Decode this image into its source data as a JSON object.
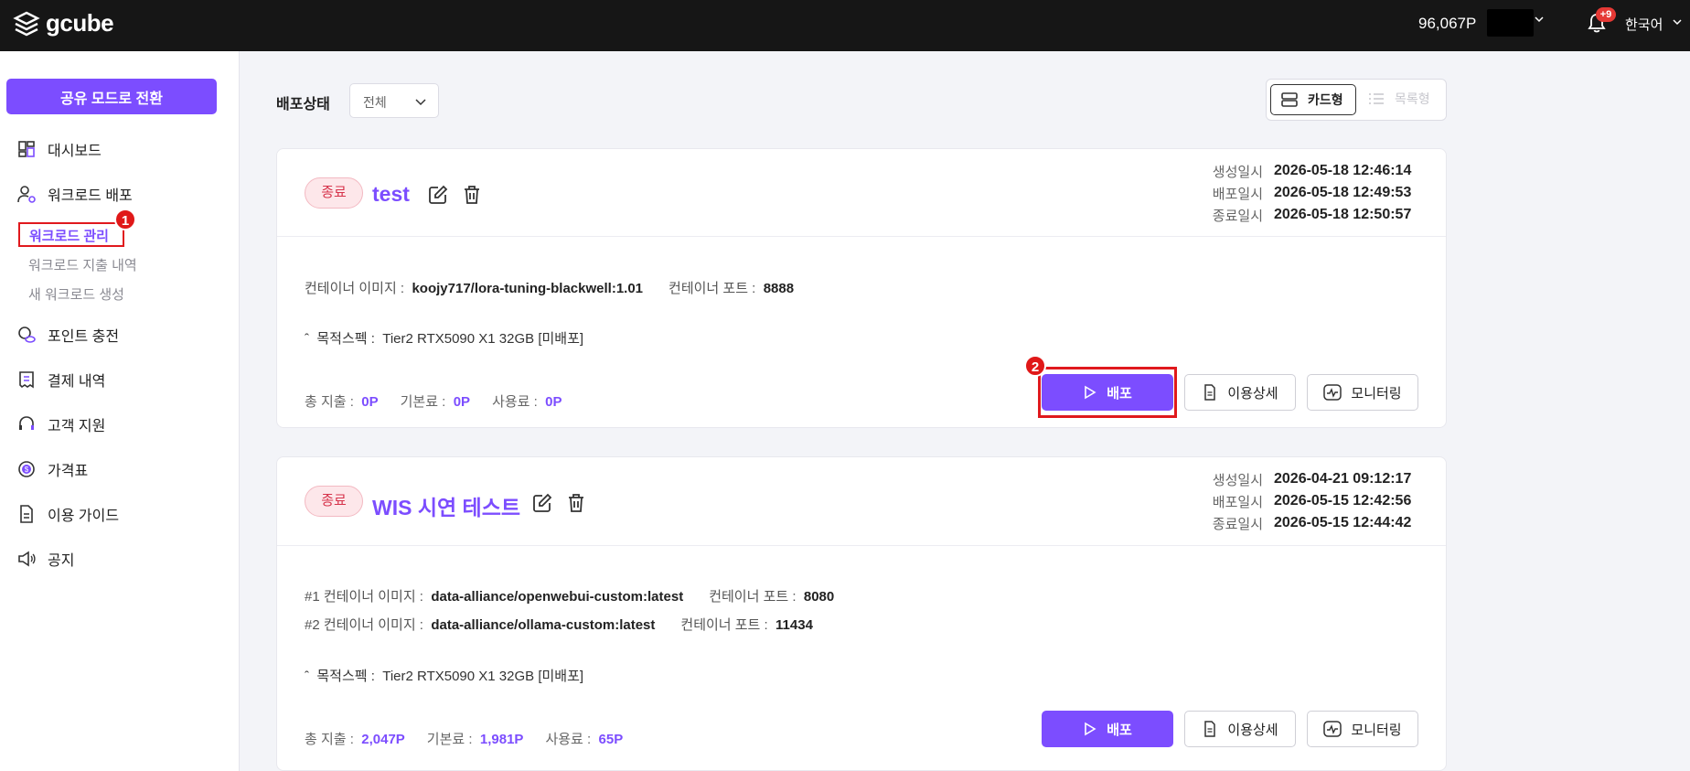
{
  "header": {
    "logo_text": "gcube",
    "points": "96,067P",
    "notification_badge": "+9",
    "language": "한국어"
  },
  "sidebar": {
    "mode_button": "공유 모드로 전환",
    "items": [
      {
        "label": "대시보드",
        "icon": "dashboard-icon"
      },
      {
        "label": "워크로드 배포",
        "icon": "user-gear-icon"
      },
      {
        "label": "포인트 충전",
        "icon": "coins-icon"
      },
      {
        "label": "결제 내역",
        "icon": "receipt-icon"
      },
      {
        "label": "고객 지원",
        "icon": "headset-icon"
      },
      {
        "label": "가격표",
        "icon": "dollar-icon"
      },
      {
        "label": "이용 가이드",
        "icon": "document-icon"
      },
      {
        "label": "공지",
        "icon": "megaphone-icon"
      }
    ],
    "sub_items": [
      "워크로드 관리",
      "워크로드 지출 내역",
      "새 워크로드 생성"
    ],
    "markers": [
      "1",
      "2"
    ]
  },
  "filter": {
    "label": "배포상태",
    "value": "전체"
  },
  "view_toggle": {
    "card": "카드형",
    "list": "목록형"
  },
  "labels": {
    "created": "생성일시",
    "deployed": "배포일시",
    "ended": "종료일시",
    "image": "컨테이너 이미지 :",
    "port": "컨테이너 포트 :",
    "spec": "목적스펙 :",
    "total": "총 지출 :",
    "base": "기본료 :",
    "usage": "사용료 :",
    "deploy_btn": "배포",
    "detail_btn": "이용상세",
    "monitor_btn": "모니터링"
  },
  "cards": [
    {
      "status": "종료",
      "title": "test",
      "created": "2026-05-18 12:46:14",
      "deployed": "2026-05-18 12:49:53",
      "ended": "2026-05-18 12:50:57",
      "images": [
        {
          "prefix": "",
          "image": "koojy717/lora-tuning-blackwell:1.01",
          "port": "8888"
        }
      ],
      "spec": "Tier2 RTX5090 X1 32GB [미배포]",
      "total": "0P",
      "base": "0P",
      "usage": "0P"
    },
    {
      "status": "종료",
      "title": "WIS 시연 테스트",
      "created": "2026-04-21 09:12:17",
      "deployed": "2026-05-15 12:42:56",
      "ended": "2026-05-15 12:44:42",
      "images": [
        {
          "prefix": "#1 ",
          "image": "data-alliance/openwebui-custom:latest",
          "port": "8080"
        },
        {
          "prefix": "#2 ",
          "image": "data-alliance/ollama-custom:latest",
          "port": "11434"
        }
      ],
      "spec": "Tier2 RTX5090 X1 32GB [미배포]",
      "total": "2,047P",
      "base": "1,981P",
      "usage": "65P"
    }
  ],
  "colors": {
    "accent": "#7c4dff",
    "status_end": "#d6334b",
    "annotation_red": "#e0191d"
  }
}
